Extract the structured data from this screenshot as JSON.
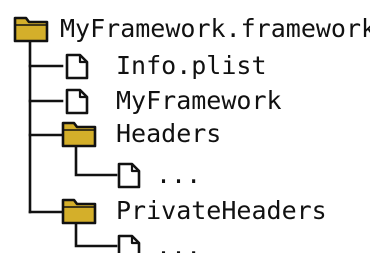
{
  "tree": {
    "root": {
      "label": "MyFramework.framework",
      "icon": "folder-icon"
    },
    "items": [
      {
        "label": "Info.plist",
        "icon": "file-icon"
      },
      {
        "label": "MyFramework",
        "icon": "file-icon"
      },
      {
        "label": "Headers",
        "icon": "folder-icon"
      },
      {
        "label": "...",
        "icon": "file-icon"
      },
      {
        "label": "PrivateHeaders",
        "icon": "folder-icon"
      },
      {
        "label": "...",
        "icon": "file-icon"
      }
    ]
  },
  "colors": {
    "folder_fill": "#D4AF2A",
    "folder_outline": "#111111",
    "line": "#111111",
    "file_fill": "#ffffff"
  }
}
